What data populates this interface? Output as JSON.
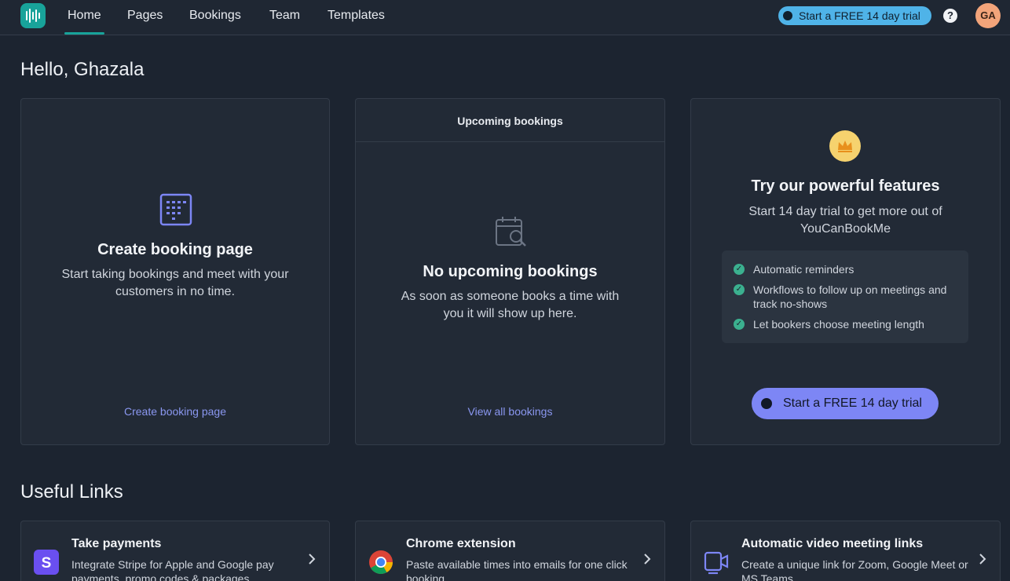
{
  "nav": {
    "items": [
      {
        "label": "Home",
        "active": true
      },
      {
        "label": "Pages"
      },
      {
        "label": "Bookings"
      },
      {
        "label": "Team"
      },
      {
        "label": "Templates"
      }
    ],
    "trial_pill": "Start a FREE 14 day trial",
    "help": "?",
    "avatar": "GA"
  },
  "greeting": "Hello, Ghazala",
  "cards": {
    "create": {
      "title": "Create booking page",
      "text": "Start taking bookings and meet with your customers in no time.",
      "link": "Create booking page"
    },
    "upcoming": {
      "header": "Upcoming bookings",
      "title": "No upcoming bookings",
      "text": "As soon as someone books a time with you it will show up here.",
      "link": "View all bookings"
    },
    "trial": {
      "title": "Try our powerful features",
      "text": "Start 14 day trial to get more out of YouCanBookMe",
      "features": [
        "Automatic reminders",
        "Workflows to follow up on meetings and track no-shows",
        "Let bookers choose meeting length"
      ],
      "cta": "Start a FREE 14 day trial"
    }
  },
  "useful_links": {
    "heading": "Useful Links",
    "items": [
      {
        "title": "Take payments",
        "desc": "Integrate Stripe for Apple and Google pay payments, promo codes & packages",
        "icon": "stripe-icon"
      },
      {
        "title": "Chrome extension",
        "desc": "Paste available times into emails for one click booking",
        "icon": "chrome-icon"
      },
      {
        "title": "Automatic video meeting links",
        "desc": "Create a unique link for Zoom, Google Meet or MS Teams",
        "icon": "video-icon"
      }
    ]
  },
  "colors": {
    "accent_teal": "#18a39a",
    "accent_purple": "#7d86f5",
    "link": "#8a97f0",
    "trial_blue": "#4fb3e8"
  }
}
